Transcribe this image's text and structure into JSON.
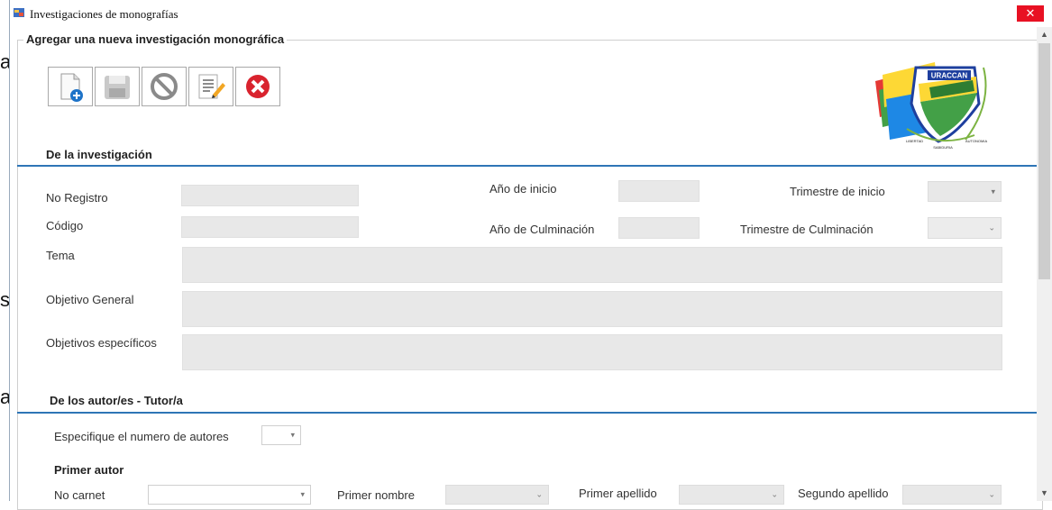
{
  "window": {
    "title": "Investigaciones de monografías",
    "close_label": "✕"
  },
  "background_fragments": [
    "a",
    "s",
    "a"
  ],
  "group_title": "Agregar una nueva investigación monográfica",
  "toolbar": {
    "buttons": [
      {
        "name": "new-document-icon"
      },
      {
        "name": "save-icon"
      },
      {
        "name": "cancel-icon"
      },
      {
        "name": "edit-icon"
      },
      {
        "name": "close-icon"
      }
    ]
  },
  "logo": {
    "text": "URACCAN",
    "motto_left": "LIBERTAD",
    "motto_center": "SABIDURIA",
    "motto_right": "AUTONOMIA"
  },
  "investigacion": {
    "section_title": "De la investigación",
    "no_registro": {
      "label": "No Registro",
      "value": ""
    },
    "codigo": {
      "label": "Código",
      "value": ""
    },
    "anio_inicio": {
      "label": "Año de  inicio",
      "value": ""
    },
    "anio_culminacion": {
      "label": "Año de Culminación",
      "value": ""
    },
    "trimestre_inicio": {
      "label": "Trimestre de inicio",
      "value": ""
    },
    "trimestre_culminacion": {
      "label": "Trimestre de Culminación",
      "value": ""
    },
    "tema": {
      "label": "Tema",
      "value": ""
    },
    "objetivo_general": {
      "label": "Objetivo General",
      "value": ""
    },
    "objetivos_especificos": {
      "label": "Objetivos específicos",
      "value": ""
    }
  },
  "autores": {
    "section_title": "De los autor/es - Tutor/a",
    "numero_autores_label": "Especifique el numero de autores",
    "numero_autores_value": "",
    "primer_autor_title": "Primer autor",
    "no_carnet_label": "No carnet",
    "primer_nombre_label": "Primer nombre",
    "primer_apellido_label": "Primer apellido",
    "segundo_apellido_label": "Segundo apellido"
  },
  "colors": {
    "accent": "#2e75b6",
    "close": "#e81123",
    "field_bg": "#e8e8e8"
  }
}
